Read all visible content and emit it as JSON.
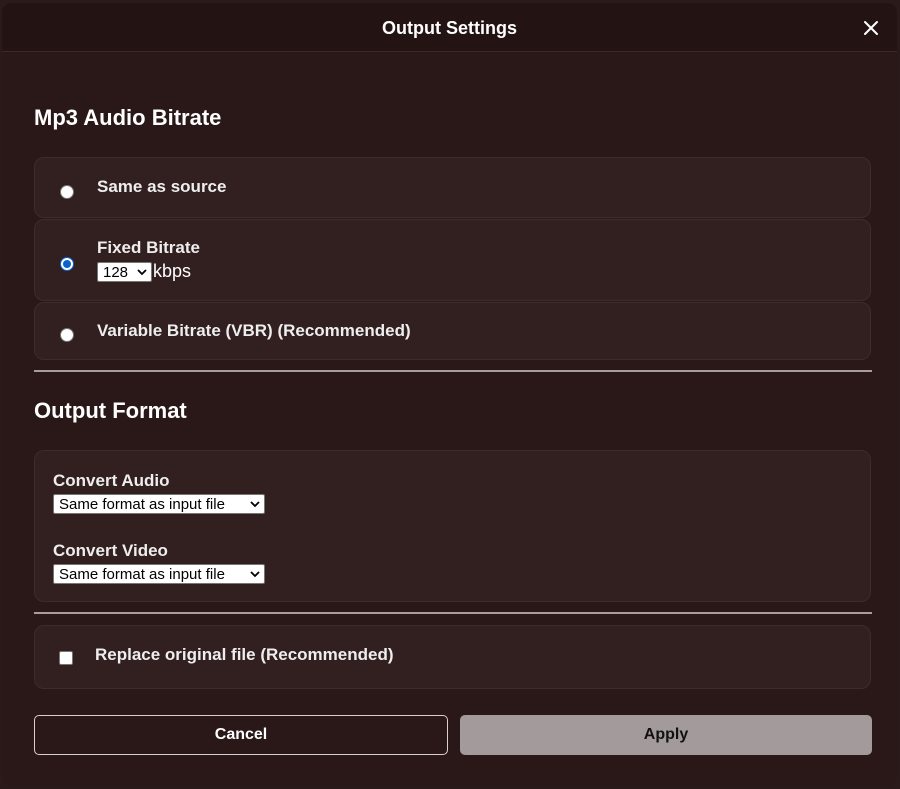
{
  "dialog": {
    "title": "Output Settings"
  },
  "bitrate": {
    "heading": "Mp3 Audio Bitrate",
    "options": [
      {
        "label": "Same as source",
        "checked": false
      },
      {
        "label": "Fixed Bitrate",
        "checked": true
      },
      {
        "label": "Variable Bitrate (VBR) (Recommended)",
        "checked": false
      }
    ],
    "fixed_value": "128",
    "fixed_unit": "kbps"
  },
  "format": {
    "heading": "Output Format",
    "audio_label": "Convert Audio",
    "audio_value": "Same format as input file",
    "video_label": "Convert Video",
    "video_value": "Same format as input file"
  },
  "replace": {
    "label": "Replace original file (Recommended)",
    "checked": false
  },
  "buttons": {
    "cancel": "Cancel",
    "apply": "Apply"
  },
  "colors": {
    "dialog_bg": "#2a1717",
    "card_bg": "#321f1f",
    "radio_accent": "#0b63c9",
    "apply_bg": "#a39b9b"
  },
  "icons": {
    "close": "close-icon",
    "dropdown": "chevron-down-icon"
  }
}
